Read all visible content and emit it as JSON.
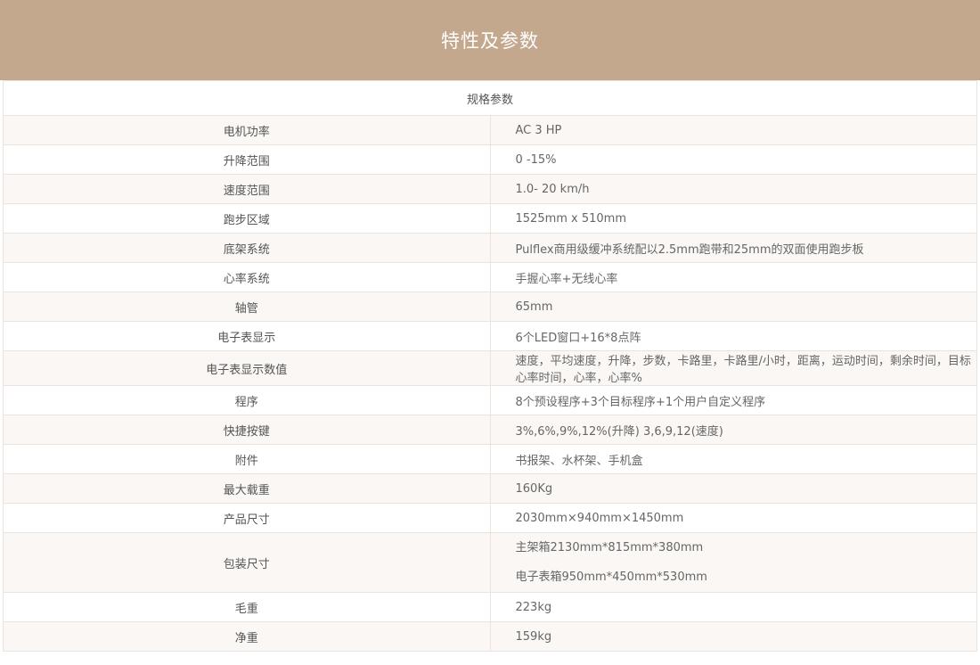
{
  "header": {
    "title": "特性及参数"
  },
  "table": {
    "caption": "规格参数",
    "rows": [
      {
        "label": "电机功率",
        "value": "AC 3 HP"
      },
      {
        "label": "升降范围",
        "value": "0 -15%"
      },
      {
        "label": "速度范围",
        "value": "1.0- 20 km/h"
      },
      {
        "label": "跑步区域",
        "value": "1525mm x 510mm"
      },
      {
        "label": "底架系统",
        "value": "Pulflex商用级缓冲系统配以2.5mm跑带和25mm的双面使用跑步板"
      },
      {
        "label": "心率系统",
        "value": "手握心率+无线心率"
      },
      {
        "label": "轴管",
        "value": "65mm"
      },
      {
        "label": "电子表显示",
        "value": "6个LED窗口+16*8点阵"
      },
      {
        "label": "电子表显示数值",
        "value": "速度，平均速度，升降，步数，卡路里，卡路里/小时，距离，运动时间，剩余时间，目标心率时间，心率，心率%"
      },
      {
        "label": "程序",
        "value": "8个预设程序+3个目标程序+1个用户自定义程序"
      },
      {
        "label": "快捷按键",
        "value": "3%,6%,9%,12%(升降) 3,6,9,12(速度)"
      },
      {
        "label": "附件",
        "value": "书报架、水杯架、手机盒"
      },
      {
        "label": "最大载重",
        "value": "160Kg"
      },
      {
        "label": "产品尺寸",
        "value": "2030mm×940mm×1450mm"
      }
    ],
    "package": {
      "label": "包装尺寸",
      "values": [
        "主架箱2130mm*815mm*380mm",
        "电子表箱950mm*450mm*530mm"
      ]
    },
    "tail_rows": [
      {
        "label": "毛重",
        "value": "223kg"
      },
      {
        "label": "净重",
        "value": "159kg"
      }
    ]
  },
  "colors": {
    "header_bg": "#c4a88d",
    "row_alt_bg": "#faf7f4",
    "border": "#ece4dc"
  }
}
